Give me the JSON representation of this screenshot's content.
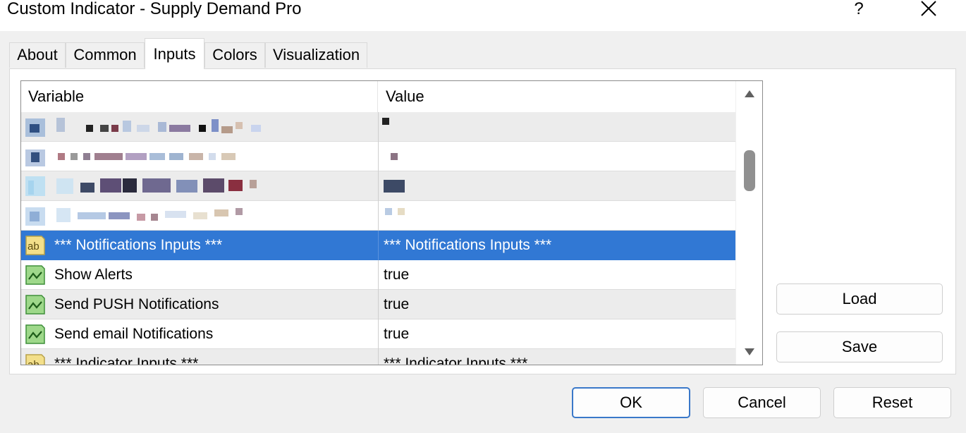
{
  "window": {
    "title": "Custom Indicator - Supply Demand Pro",
    "help_label": "?"
  },
  "tabs": [
    {
      "label": "About"
    },
    {
      "label": "Common"
    },
    {
      "label": "Inputs"
    },
    {
      "label": "Colors"
    },
    {
      "label": "Visualization"
    }
  ],
  "active_tab": "Inputs",
  "table": {
    "headers": {
      "variable": "Variable",
      "value": "Value"
    },
    "visible_rows": [
      {
        "variable": "*** Notifications Inputs ***",
        "value": "*** Notifications Inputs ***",
        "icon": "text-ab-icon",
        "selected": true
      },
      {
        "variable": "Show Alerts",
        "value": "true",
        "icon": "boolean-icon"
      },
      {
        "variable": "Send PUSH Notifications",
        "value": "true",
        "icon": "boolean-icon"
      },
      {
        "variable": "Send email Notifications",
        "value": "true",
        "icon": "boolean-icon"
      },
      {
        "variable": "*** Indicator Inputs ***",
        "value": "*** Indicator Inputs ***",
        "icon": "text-ab-icon",
        "partial": true
      }
    ]
  },
  "buttons": {
    "load": "Load",
    "save": "Save",
    "ok": "OK",
    "cancel": "Cancel",
    "reset": "Reset"
  },
  "colors": {
    "selection": "#3178d4",
    "window_bg": "#f0f0f0",
    "primary_border": "#3a78c9"
  }
}
